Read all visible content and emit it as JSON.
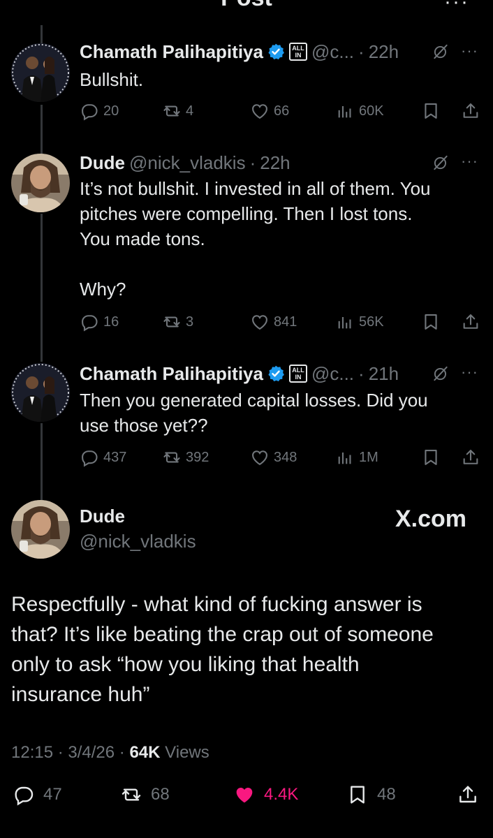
{
  "header": {
    "title": "Post"
  },
  "replies": [
    {
      "name": "Chamath Palihapitiya",
      "affiliate": "ALL IN",
      "handle": "@c...",
      "time": "22h",
      "text": "Bullshit.",
      "stats": {
        "replies": "20",
        "reposts": "4",
        "likes": "66",
        "views": "60K"
      }
    },
    {
      "name": "Dude",
      "handle": "@nick_vladkis",
      "time": "22h",
      "text": "It’s not bullshit. I invested in all of them. You\npitches were compelling. Then I lost tons.\nYou made tons.\n\nWhy?",
      "stats": {
        "replies": "16",
        "reposts": "3",
        "likes": "841",
        "views": "56K"
      }
    },
    {
      "name": "Chamath Palihapitiya",
      "affiliate": "ALL IN",
      "handle": "@c...",
      "time": "21h",
      "text": "Then you generated capital losses. Did you\nuse those yet??",
      "stats": {
        "replies": "437",
        "reposts": "392",
        "likes": "348",
        "views": "1M"
      }
    }
  ],
  "main": {
    "name": "Dude",
    "handle": "@nick_vladkis",
    "watermark": "X.com",
    "text": "Respectfully - what kind of fucking answer is\nthat? It’s like beating the crap out of someone\nonly to ask “how you liking that health\ninsurance huh”",
    "time": "12:15",
    "date": "3/4/26",
    "views_count": "64K",
    "views_label": "Views",
    "stats": {
      "replies": "47",
      "reposts": "68",
      "likes": "4.4K",
      "bookmarks": "48"
    }
  },
  "colors": {
    "background": "#000000",
    "text": "#e7e9ea",
    "muted": "#71767b",
    "verified": "#1d9bf0",
    "like_active": "#f91880",
    "thread_line": "#333639"
  },
  "icons": [
    "back-arrow-icon",
    "more-icon",
    "verified-badge-icon",
    "grok-icon",
    "reply-icon",
    "repost-icon",
    "like-icon",
    "views-icon",
    "bookmark-icon",
    "share-icon"
  ]
}
